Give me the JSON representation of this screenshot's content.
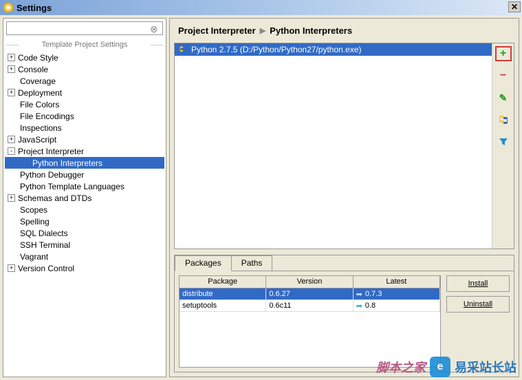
{
  "window": {
    "title": "Settings"
  },
  "search": {
    "placeholder": ""
  },
  "tree": {
    "section_header": "Template Project Settings",
    "items": [
      {
        "label": "Code Style",
        "toggle": "+",
        "indent": 0
      },
      {
        "label": "Console",
        "toggle": "+",
        "indent": 0
      },
      {
        "label": "Coverage",
        "toggle": null,
        "indent": 1
      },
      {
        "label": "Deployment",
        "toggle": "+",
        "indent": 0
      },
      {
        "label": "File Colors",
        "toggle": null,
        "indent": 1
      },
      {
        "label": "File Encodings",
        "toggle": null,
        "indent": 1
      },
      {
        "label": "Inspections",
        "toggle": null,
        "indent": 1
      },
      {
        "label": "JavaScript",
        "toggle": "+",
        "indent": 0
      },
      {
        "label": "Project Interpreter",
        "toggle": "-",
        "indent": 0
      },
      {
        "label": "Python Interpreters",
        "toggle": null,
        "indent": 2,
        "selected": true
      },
      {
        "label": "Python Debugger",
        "toggle": null,
        "indent": 1
      },
      {
        "label": "Python Template Languages",
        "toggle": null,
        "indent": 1
      },
      {
        "label": "Schemas and DTDs",
        "toggle": "+",
        "indent": 0
      },
      {
        "label": "Scopes",
        "toggle": null,
        "indent": 1
      },
      {
        "label": "Spelling",
        "toggle": null,
        "indent": 1
      },
      {
        "label": "SQL Dialects",
        "toggle": null,
        "indent": 1
      },
      {
        "label": "SSH Terminal",
        "toggle": null,
        "indent": 1
      },
      {
        "label": "Vagrant",
        "toggle": null,
        "indent": 1
      },
      {
        "label": "Version Control",
        "toggle": "+",
        "indent": 0
      }
    ]
  },
  "breadcrumb": {
    "part1": "Project Interpreter",
    "part2": "Python Interpreters"
  },
  "interpreters": {
    "rows": [
      {
        "label": "Python 2.7.5 (D:/Python/Python27/python.exe)"
      }
    ]
  },
  "tabs": {
    "packages": "Packages",
    "paths": "Paths"
  },
  "packages_table": {
    "headers": {
      "package": "Package",
      "version": "Version",
      "latest": "Latest"
    },
    "rows": [
      {
        "package": "distribute",
        "version": "0.6.27",
        "latest": "0.7.3",
        "selected": true
      },
      {
        "package": "setuptools",
        "version": "0.6c11",
        "latest": "0.8",
        "selected": false
      }
    ]
  },
  "buttons": {
    "install": "Install",
    "uninstall": "Uninstall"
  },
  "toolbar": {
    "add": "+",
    "remove": "−",
    "edit": "✎",
    "filter": "▼"
  },
  "watermark": {
    "cn": "脚本之家",
    "text": "易采站长站"
  }
}
